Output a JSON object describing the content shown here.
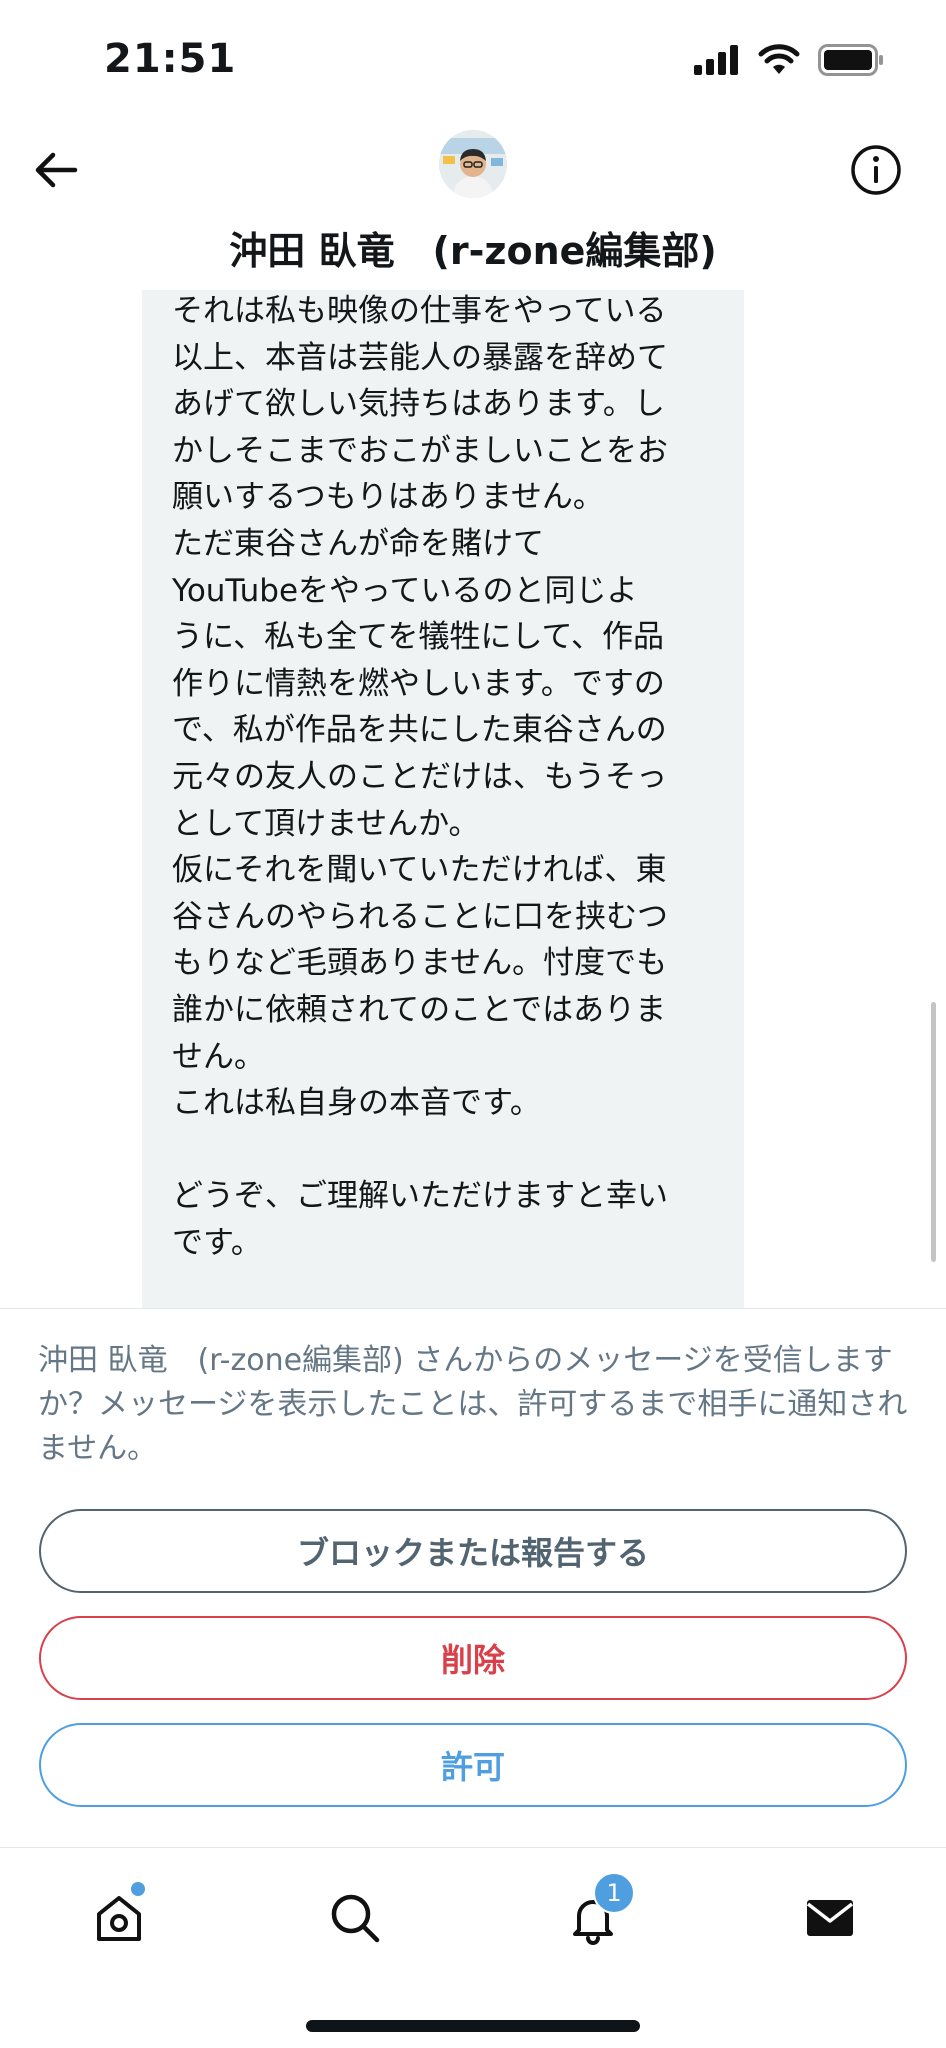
{
  "status_bar": {
    "time": "21:51"
  },
  "header": {
    "display_name": "沖田 臥竜　(r-zone編集部)"
  },
  "message": {
    "text": "それは私も映像の仕事をやっている\n以上、本音は芸能人の暴露を辞めて\nあげて欲しい気持ちはあります。し\nかしそこまでおこがましいことをお\n願いするつもりはありません。\nただ東谷さんが命を賭けて\nYouTubeをやっているのと同じよ\nうに、私も全てを犠牲にして、作品\n作りに情熱を燃やしいます。ですの\nで、私が作品を共にした東谷さんの\n元々の友人のことだけは、もうそっ\nとして頂けませんか。\n仮にそれを聞いていただければ、東\n谷さんのやられることに口を挟むつ\nもりなど毛頭ありません。忖度でも\n誰かに依頼されてのことではありま\nせん。\nこれは私自身の本音です。\n\nどうぞ、ご理解いただけますと幸い\nです。"
  },
  "request": {
    "prompt": "沖田 臥竜　(r-zone編集部) さんからのメッセージを受信しますか？メッセージを表示したことは、許可するまで相手に通知されません。",
    "block_label": "ブロックまたは報告する",
    "delete_label": "削除",
    "allow_label": "許可"
  },
  "tab_bar": {
    "notifications_badge": "1"
  },
  "colors": {
    "accent_blue": "#4f9fe0",
    "danger_red": "#d9404a",
    "neutral_gray": "#536471",
    "bubble_bg": "#eff3f4"
  },
  "icons": {
    "back": "arrow-left-icon",
    "info": "info-icon",
    "home": "home-icon",
    "search": "search-icon",
    "notifications": "bell-icon",
    "messages": "envelope-icon"
  }
}
